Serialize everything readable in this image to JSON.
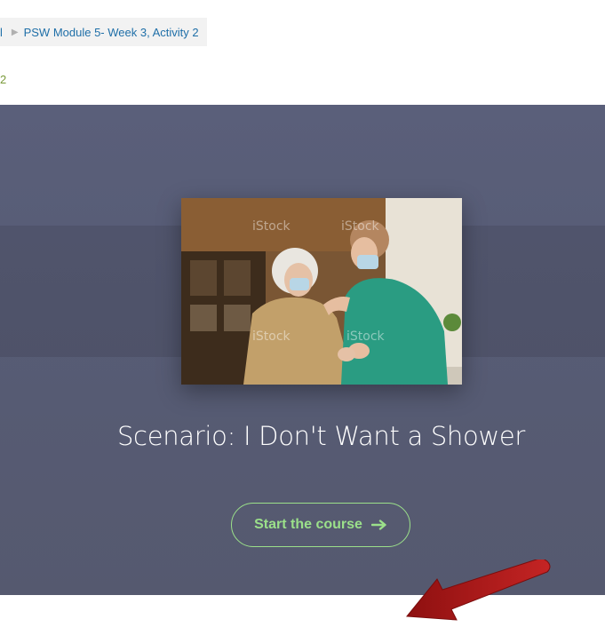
{
  "breadcrumb": {
    "previous": "l",
    "current": "PSW Module 5- Week 3, Activity 2"
  },
  "page_link": "2",
  "course": {
    "title": "Scenario: I Don't Want a Shower",
    "start_label": "Start the course",
    "image_icon": "photo-nurse-and-elderly-patient"
  },
  "colors": {
    "hero_bg": "#575c75",
    "accent_green": "#9be08a",
    "link_blue": "#1f6fa8",
    "annotation_red": "#b01c1c"
  }
}
